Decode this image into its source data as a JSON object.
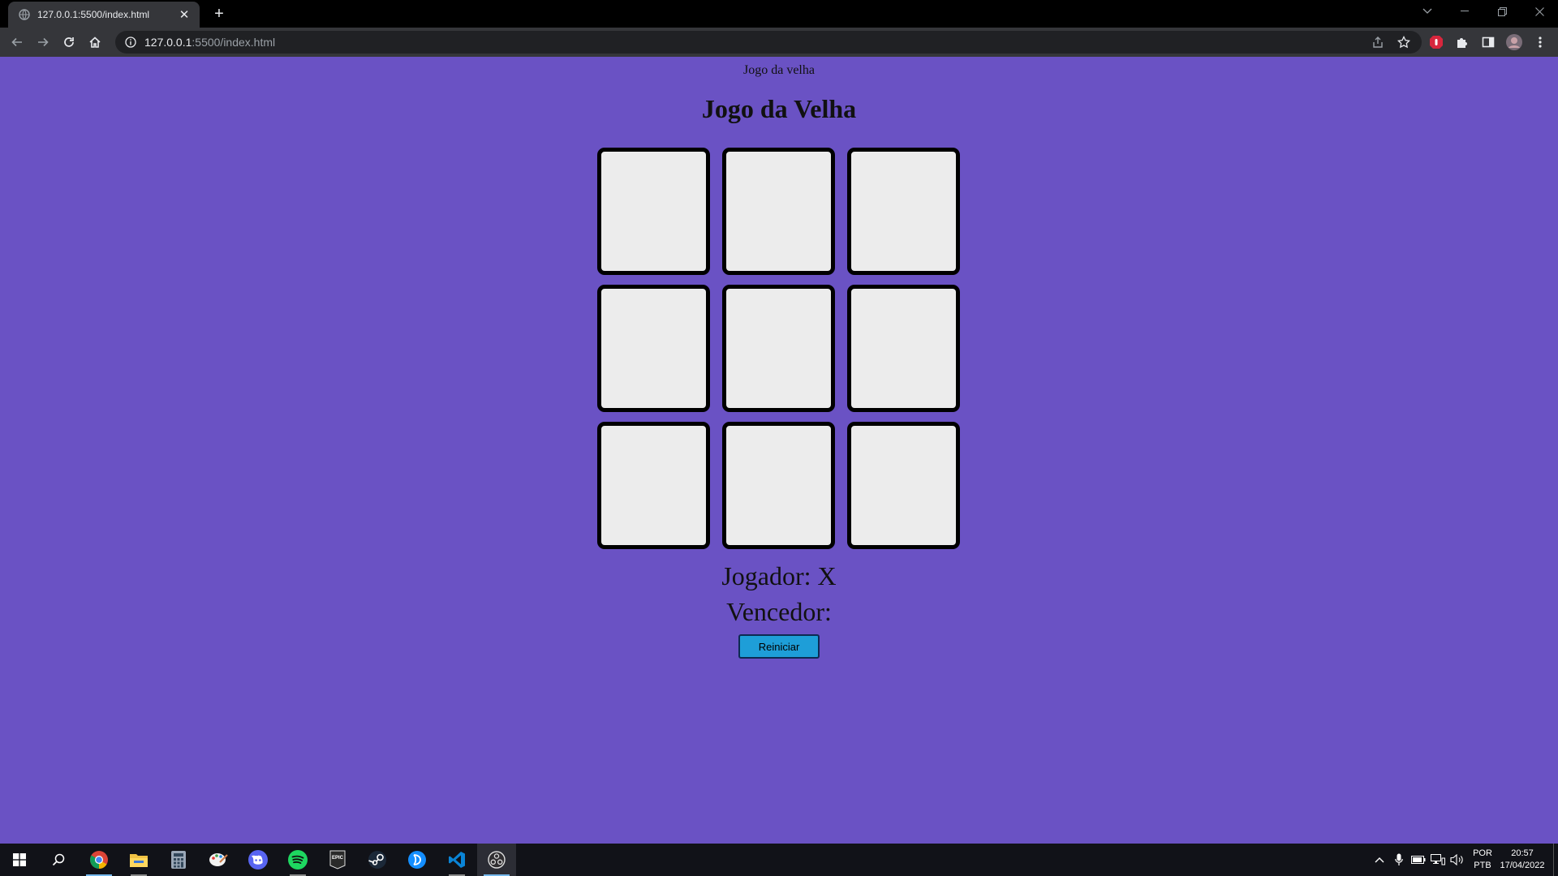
{
  "browser": {
    "tab_title": "127.0.0.1:5500/index.html",
    "url_host": "127.0.0.1",
    "url_path": ":5500/index.html"
  },
  "page": {
    "doc_title": "Jogo da velha",
    "heading": "Jogo da Velha",
    "board": [
      "",
      "",
      "",
      "",
      "",
      "",
      "",
      "",
      ""
    ],
    "player_label": "Jogador: X",
    "winner_label": "Vencedor:",
    "restart_label": "Reiniciar",
    "colors": {
      "background": "#6a52c4",
      "cell": "#ececec",
      "button": "#1e9ed8"
    }
  },
  "taskbar": {
    "apps": [
      "windows-start-icon",
      "search-icon",
      "chrome-icon",
      "file-explorer-icon",
      "calculator-icon",
      "paint-icon",
      "discord-icon",
      "spotify-icon",
      "epic-games-icon",
      "steam-icon",
      "battlenet-icon",
      "vscode-icon",
      "obs-icon"
    ],
    "epic_label": "EPIC",
    "lang_top": "POR",
    "lang_bottom": "PTB",
    "time": "20:57",
    "date": "17/04/2022"
  }
}
